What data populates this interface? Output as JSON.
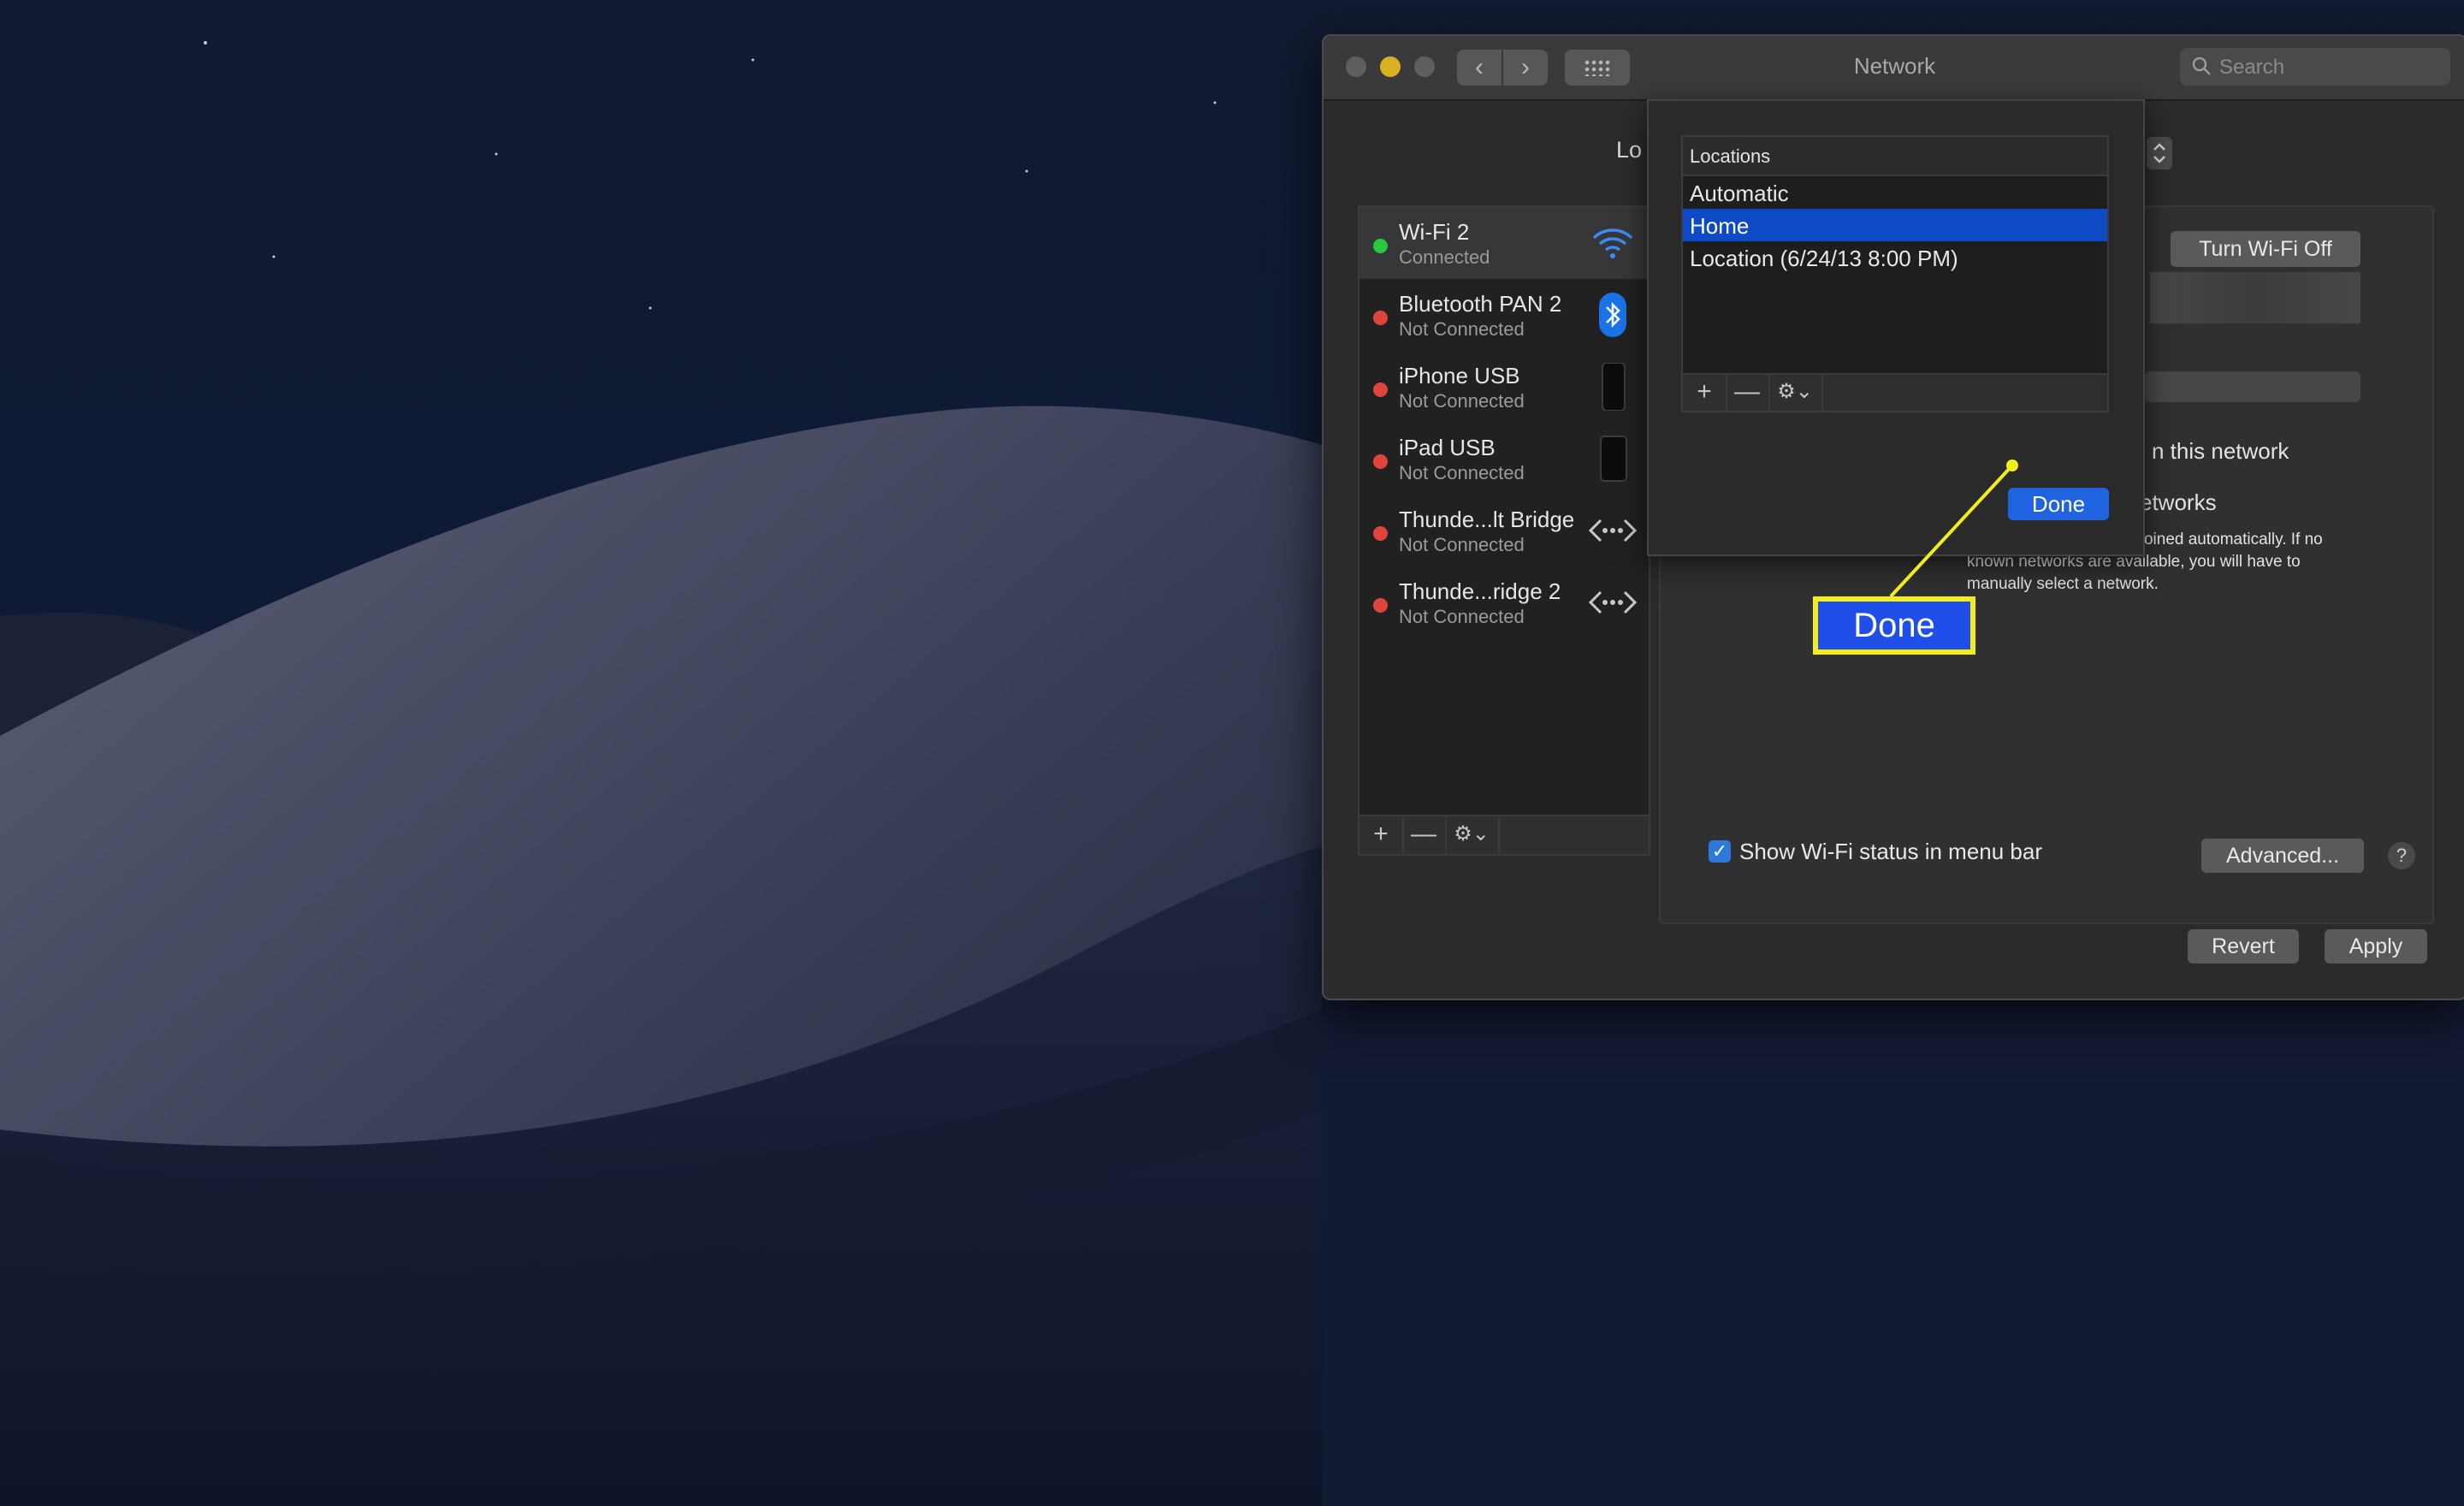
{
  "window": {
    "title": "Network",
    "search_placeholder": "Search",
    "location_label": "Lo"
  },
  "services": [
    {
      "name": "Wi-Fi 2",
      "status": "Connected",
      "status_color": "#28c840",
      "icon": "wifi-icon"
    },
    {
      "name": "Bluetooth PAN 2",
      "status": "Not Connected",
      "status_color": "#e0443e",
      "icon": "bluetooth-icon"
    },
    {
      "name": "iPhone USB",
      "status": "Not Connected",
      "status_color": "#e0443e",
      "icon": "iphone-icon"
    },
    {
      "name": "iPad USB",
      "status": "Not Connected",
      "status_color": "#e0443e",
      "icon": "ipad-icon"
    },
    {
      "name": "Thunde...lt Bridge",
      "status": "Not Connected",
      "status_color": "#e0443e",
      "icon": "thunderbolt-bridge-icon"
    },
    {
      "name": "Thunde...ridge 2",
      "status": "Not Connected",
      "status_color": "#e0443e",
      "icon": "thunderbolt-bridge-icon"
    }
  ],
  "sidebar_toolbar": {
    "add": "+",
    "remove": "—",
    "gear": "⚙⌄"
  },
  "locations_sheet": {
    "header": "Locations",
    "items": [
      "Automatic",
      "Home",
      "Location (6/24/13 8:00 PM)"
    ],
    "selected": "Home",
    "done_label": "Done"
  },
  "panel": {
    "turn_off_label": "Turn Wi-Fi Off",
    "network_text_1": "n this network",
    "network_text_2": "etworks",
    "known_networks_text": "Known networks will be joined automatically. If no known networks are available, you will have to manually select a network.",
    "show_status_label": "Show Wi-Fi status in menu bar",
    "show_status_checked": true,
    "advanced_label": "Advanced...",
    "help_label": "?"
  },
  "footer": {
    "revert_label": "Revert",
    "apply_label": "Apply"
  },
  "callout": {
    "label": "Done",
    "border_color": "#f2ed1b",
    "fill_color": "#1f4fe8"
  },
  "colors": {
    "accent_blue": "#0f4ac6",
    "connected": "#28c840",
    "not_connected": "#e0443e"
  }
}
